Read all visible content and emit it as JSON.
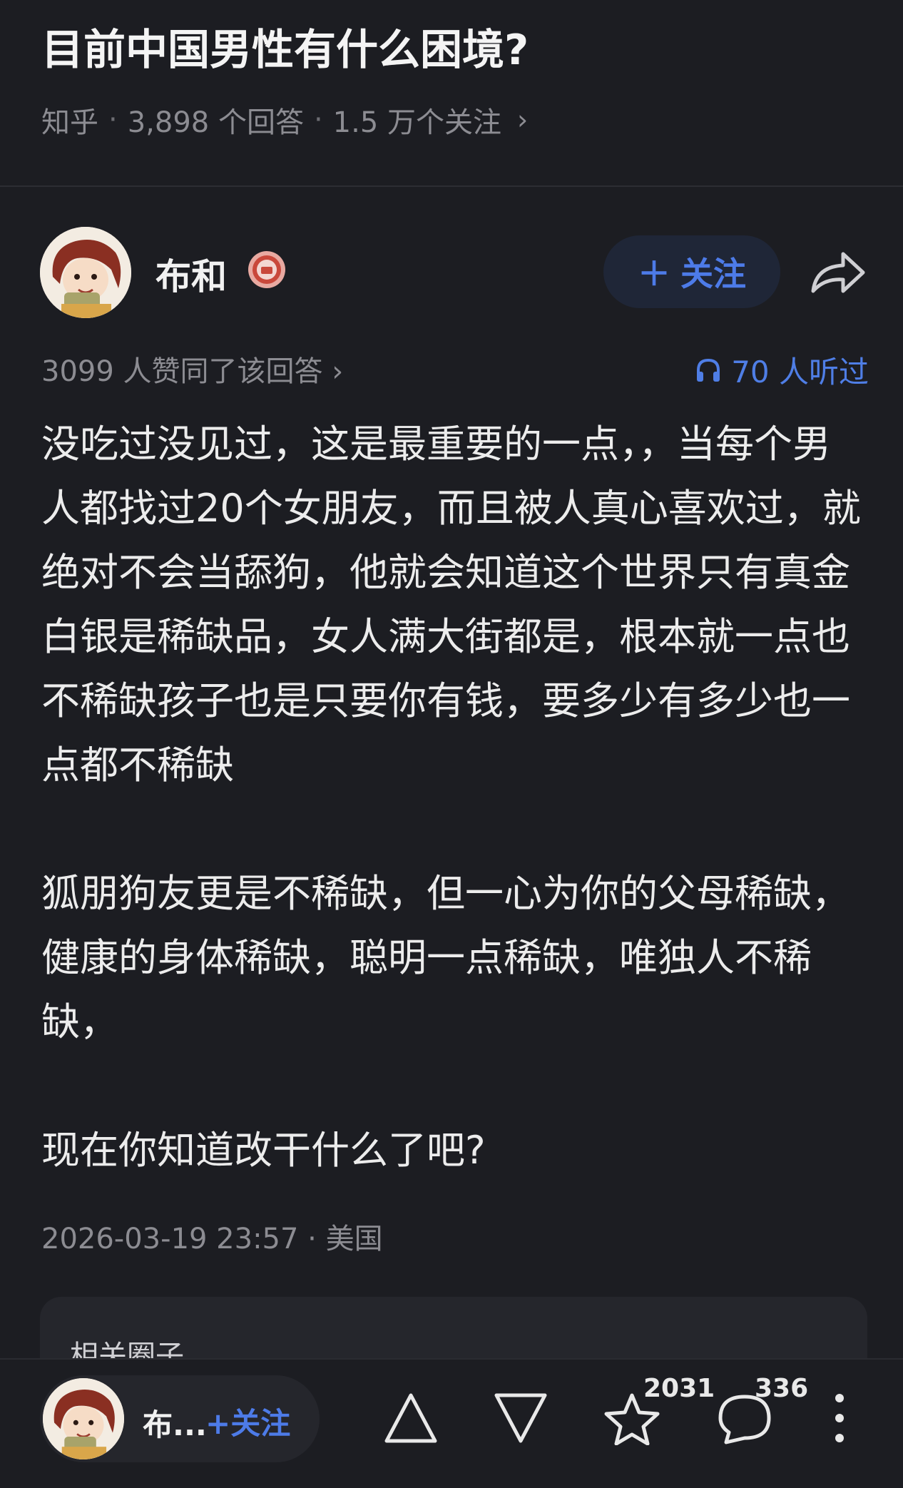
{
  "question": {
    "title": "目前中国男性有什么困境?",
    "source": "知乎",
    "answers": "3,898 个回答",
    "followers": "1.5 万个关注"
  },
  "author": {
    "name": "布和",
    "follow_label": "关注",
    "short_name": "布..."
  },
  "stats": {
    "upvotes": "3099 人赞同了该回答",
    "listened": "70 人听过"
  },
  "content": {
    "paragraphs": [
      "没吃过没见过，这是最重要的一点，，当每个男人都找过20个女朋友，而且被人真心喜欢过，就绝对不会当舔狗，他就会知道这个世界只有真金白银是稀缺品，女人满大街都是，根本就一点也不稀缺孩子也是只要你有钱，要多少有多少也一点都不稀缺",
      "狐朋狗友更是不稀缺，但一心为你的父母稀缺，健康的身体稀缺，聪明一点稀缺，唯独人不稀缺，",
      "现在你知道改干什么了吧?"
    ]
  },
  "post": {
    "time": "2026-03-19 23:57",
    "location": "美国"
  },
  "related": {
    "title": "相关圈子"
  },
  "bottom_bar": {
    "favorite_count": "2031",
    "comment_count": "336"
  },
  "colors": {
    "background": "#1c1d22",
    "accent": "#4d7be8",
    "muted_text": "#8c8c92"
  }
}
